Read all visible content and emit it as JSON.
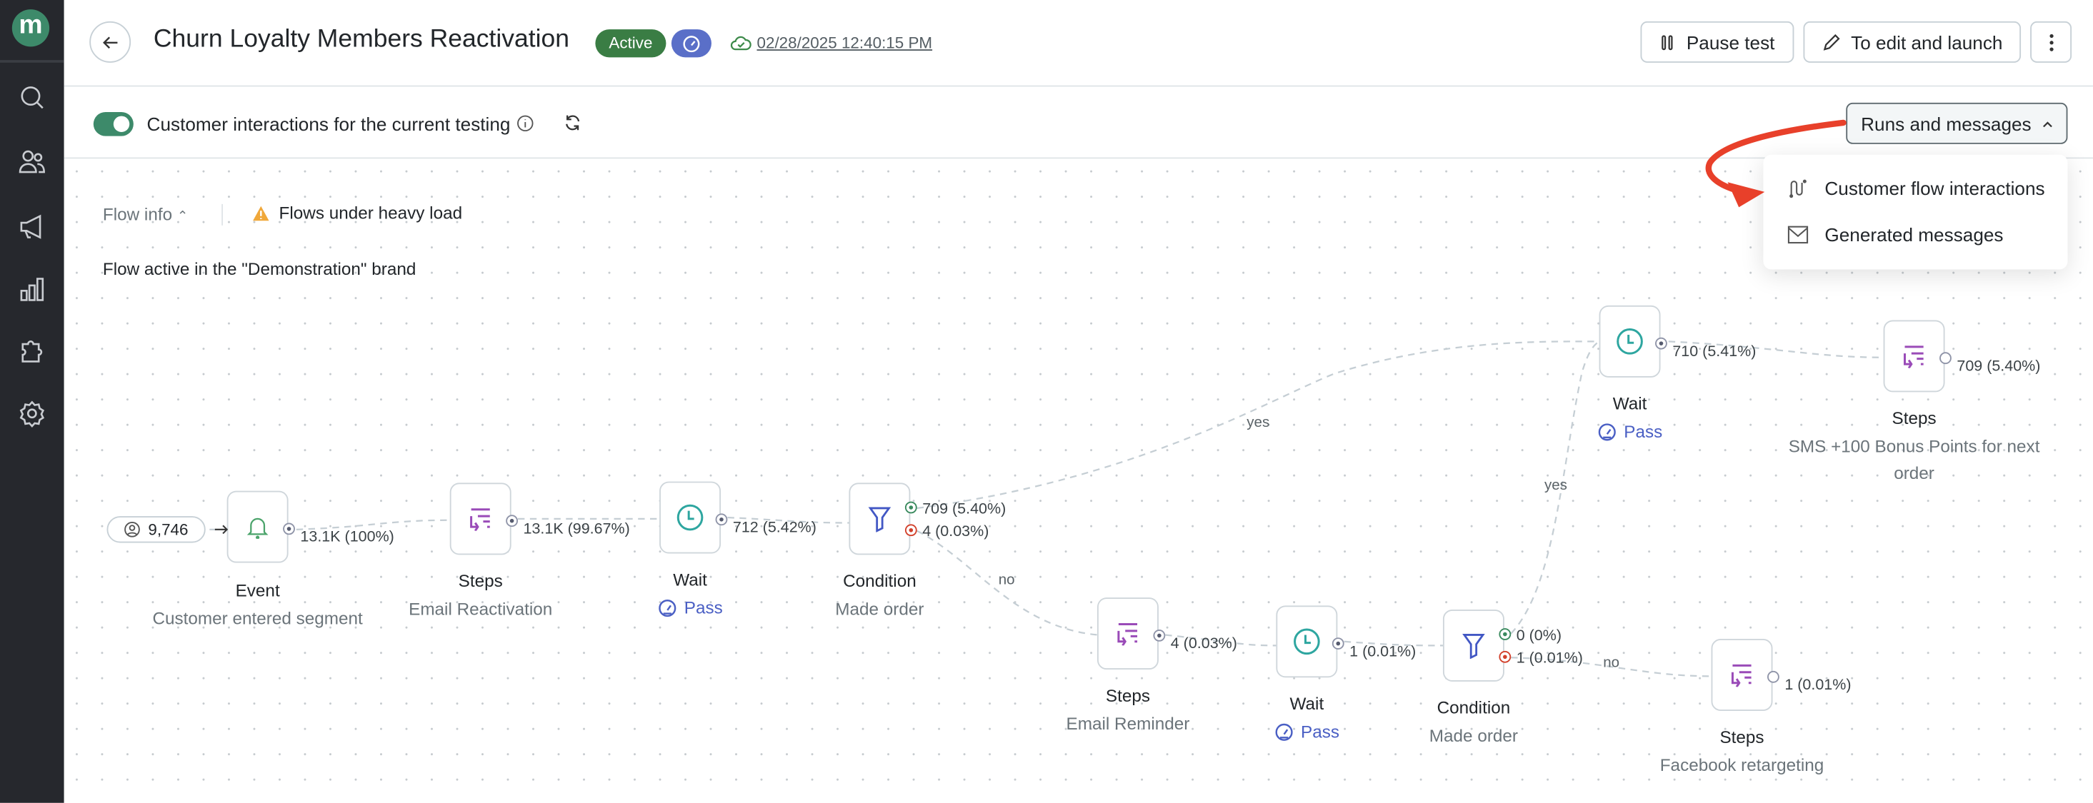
{
  "sidebar": {
    "logo": "m",
    "icons": [
      "search-icon",
      "users-icon",
      "megaphone-icon",
      "bar-chart-icon",
      "puzzle-icon",
      "gear-icon"
    ]
  },
  "header": {
    "title": "Churn Loyalty Members Reactivation",
    "status_badge": "Active",
    "saved_at": "02/28/2025 12:40:15 PM",
    "buttons": {
      "pause": "Pause test",
      "edit": "To edit and launch"
    }
  },
  "subbar": {
    "toggle_on": true,
    "label": "Customer interactions for the current testing",
    "runs_button": "Runs and messages"
  },
  "dropdown": {
    "items": [
      {
        "label": "Customer flow interactions",
        "icon": "flow-icon"
      },
      {
        "label": "Generated messages",
        "icon": "mail-icon"
      }
    ]
  },
  "info": {
    "flow_info": "Flow info",
    "warning": "Flows under heavy load",
    "brand_note": "Flow active in the \"Demonstration\" brand"
  },
  "colors": {
    "accent": "#3d8a6a",
    "active": "#3a7d44",
    "pass": "#4a5fc4",
    "annotation": "#e8402a"
  },
  "flow": {
    "entry_count": "9,746",
    "nodes": [
      {
        "type": "event",
        "title": "Event",
        "subtitle": "Customer entered segment",
        "outputs": [
          "13.1K (100%)"
        ]
      },
      {
        "type": "steps",
        "title": "Steps",
        "subtitle": "Email Reactivation",
        "outputs": [
          "13.1K (99.67%)"
        ]
      },
      {
        "type": "wait",
        "title": "Wait",
        "pass": "Pass",
        "outputs": [
          "712 (5.42%)"
        ]
      },
      {
        "type": "condition",
        "title": "Condition",
        "subtitle": "Made order",
        "outputs": [
          "709 (5.40%)",
          "4 (0.03%)"
        ]
      },
      {
        "type": "wait",
        "title": "Wait",
        "pass": "Pass",
        "outputs": [
          "710 (5.41%)"
        ]
      },
      {
        "type": "steps",
        "title": "Steps",
        "subtitle": "SMS +100 Bonus Points for next order",
        "outputs": [
          "709 (5.40%)"
        ]
      },
      {
        "type": "steps",
        "title": "Steps",
        "subtitle": "Email Reminder",
        "outputs": [
          "4 (0.03%)"
        ]
      },
      {
        "type": "wait",
        "title": "Wait",
        "pass": "Pass",
        "outputs": [
          "1 (0.01%)"
        ]
      },
      {
        "type": "condition",
        "title": "Condition",
        "subtitle": "Made order",
        "outputs": [
          "0 (0%)",
          "1 (0.01%)"
        ]
      },
      {
        "type": "steps",
        "title": "Steps",
        "subtitle": "Facebook retargeting",
        "outputs": [
          "1 (0.01%)"
        ]
      }
    ],
    "edge_labels": [
      "yes",
      "no",
      "yes",
      "no"
    ]
  }
}
